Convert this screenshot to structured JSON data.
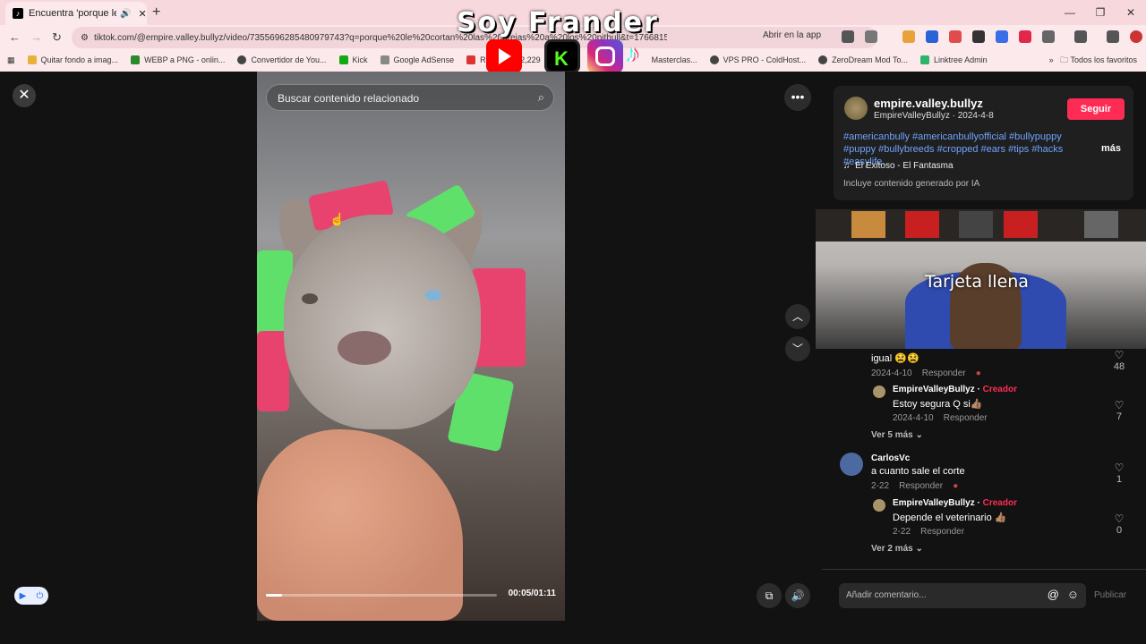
{
  "browser": {
    "tab_title": "Encuentra 'porque le corta",
    "url": "tiktok.com/@empire.valley.bullyz/video/7355696285480979743?q=porque%20le%20cortan%20las%20orejas%20a%20los%20pitbull&t=1766815811990",
    "open_in_app": "Abrir en la app",
    "bookmarks": [
      "Quitar fondo a imag...",
      "WEBP a PNG - onlin...",
      "Convertidor de You...",
      "Kick",
      "Google AdSense",
      "Recibidos (2,229",
      "Masterclas...",
      "VPS PRO - ColdHost...",
      "ZeroDream Mod To...",
      "Linktree Admin"
    ],
    "all_bookmarks": "Todos los favoritos"
  },
  "overlay": {
    "streamer_title": "Soy Frander"
  },
  "video": {
    "search_placeholder": "Buscar contenido relacionado",
    "time": "00:05/01:11",
    "progress": 0.07
  },
  "post": {
    "username": "empire.valley.bullyz",
    "subline": "EmpireValleyBullyz · 2024-4-8",
    "follow_label": "Seguir",
    "tags": "#americanbully #americanbullyofficial #bullypuppy #puppy #bullybreeds #cropped #ears #tips #hacks #easylife...",
    "more": "más",
    "music": "El Exitoso - El Fantasma",
    "ai_notice": "Incluye contenido generado por IA"
  },
  "webcam": {
    "caption": "Tarjeta llena"
  },
  "comments": {
    "c1": {
      "text": "igual 😫😫",
      "date": "2024-4-10",
      "reply": "Responder",
      "likes": "48"
    },
    "r1": {
      "name": "EmpireValleyBullyz",
      "tag": "Creador",
      "text": "Estoy segura Q si👍🏽",
      "date": "2024-4-10",
      "reply": "Responder",
      "likes": "7"
    },
    "more1": "Ver 5 más",
    "c2": {
      "name": "CarlosVc",
      "text": "a cuanto sale el corte",
      "date": "2-22",
      "reply": "Responder",
      "likes": "1"
    },
    "r2": {
      "name": "EmpireValleyBullyz",
      "tag": "Creador",
      "text": "Depende el veterinario 👍🏽",
      "date": "2-22",
      "reply": "Responder",
      "likes": "0"
    },
    "more2": "Ver 2 más"
  },
  "composer": {
    "placeholder": "Añadir comentario...",
    "publish": "Publicar"
  }
}
